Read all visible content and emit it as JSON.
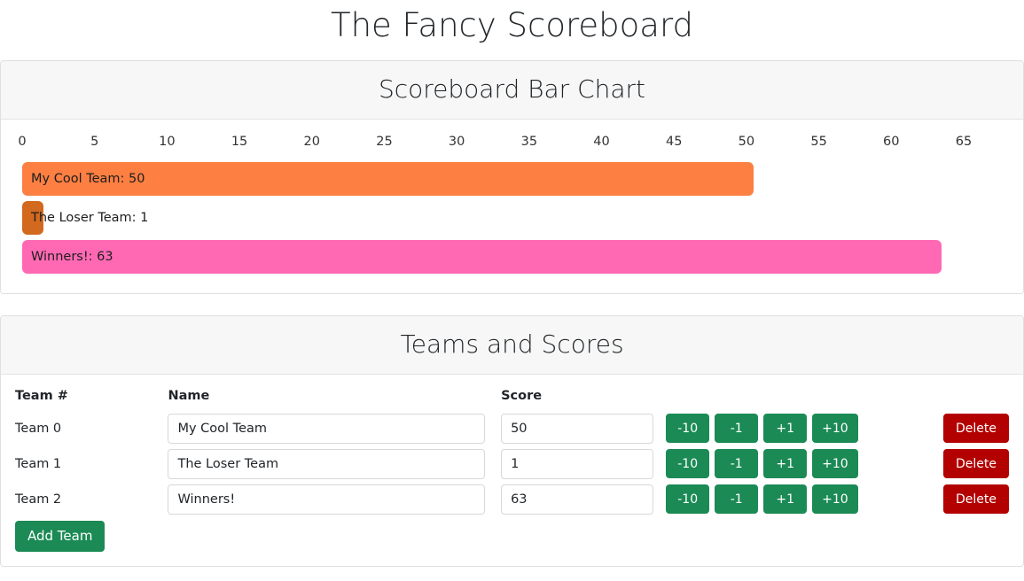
{
  "page": {
    "title": "The Fancy Scoreboard"
  },
  "chart_card": {
    "header": "Scoreboard Bar Chart"
  },
  "table_card": {
    "header": "Teams and Scores",
    "columns": [
      "Team #",
      "Name",
      "Score"
    ],
    "add_team_label": "Add Team",
    "delete_label": "Delete",
    "score_buttons": [
      "-10",
      "-1",
      "+1",
      "+10"
    ],
    "rows": [
      {
        "team_label": "Team 0",
        "name": "My Cool Team",
        "score": "50"
      },
      {
        "team_label": "Team 1",
        "name": "The Loser Team",
        "score": "1"
      },
      {
        "team_label": "Team 2",
        "name": "Winners!",
        "score": "63"
      }
    ]
  },
  "chart_data": {
    "type": "bar",
    "orientation": "horizontal",
    "title": "Scoreboard Bar Chart",
    "xlabel": "",
    "ylabel": "",
    "categories": [
      "My Cool Team",
      "The Loser Team",
      "Winners!"
    ],
    "values": [
      50,
      1,
      63
    ],
    "bar_labels": [
      "My Cool Team: 50",
      "The Loser Team: 1",
      "Winners!: 63"
    ],
    "colors": [
      "#fd7f42",
      "#d2691e",
      "#ff69b4"
    ],
    "xlim": [
      0,
      68
    ],
    "xticks": [
      0,
      5,
      10,
      15,
      20,
      25,
      30,
      35,
      40,
      45,
      50,
      55,
      60,
      65
    ],
    "xtick_labels": [
      "0",
      "5",
      "10",
      "15",
      "20",
      "25",
      "30",
      "35",
      "40",
      "45",
      "50",
      "55",
      "60",
      "65"
    ],
    "grid": false,
    "legend": false
  }
}
